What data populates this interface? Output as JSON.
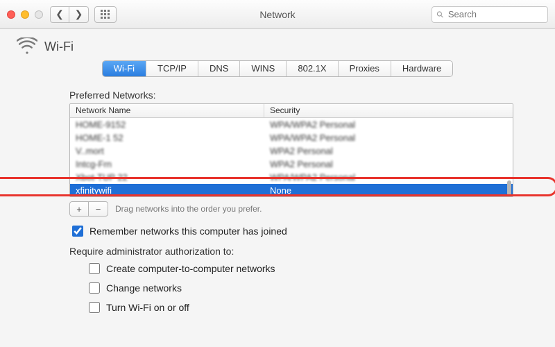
{
  "window": {
    "title": "Network"
  },
  "search": {
    "placeholder": "Search"
  },
  "page": {
    "heading": "Wi-Fi"
  },
  "tabs": {
    "t0": "Wi-Fi",
    "t1": "TCP/IP",
    "t2": "DNS",
    "t3": "WINS",
    "t4": "802.1X",
    "t5": "Proxies",
    "t6": "Hardware"
  },
  "preferred": {
    "label": "Preferred Networks:",
    "columns": {
      "name": "Network Name",
      "security": "Security"
    },
    "rows": [
      {
        "name": "HOME-9152",
        "security": "WPA/WPA2 Personal"
      },
      {
        "name": "HOME-1 52",
        "security": "WPA/WPA2 Personal"
      },
      {
        "name": "V..mort",
        "security": "WPA2 Personal"
      },
      {
        "name": "Intcg-Frn",
        "security": "WPA2 Personal"
      },
      {
        "name": "Xbot-TUP 22",
        "security": "WPA/WPA2 Personal"
      },
      {
        "name": "xfinitywifi",
        "security": "None"
      }
    ],
    "hint": "Drag networks into the order you prefer."
  },
  "options": {
    "remember": "Remember networks this computer has joined",
    "require_label": "Require administrator authorization to:",
    "opt1": "Create computer-to-computer networks",
    "opt2": "Change networks",
    "opt3": "Turn Wi-Fi on or off"
  }
}
